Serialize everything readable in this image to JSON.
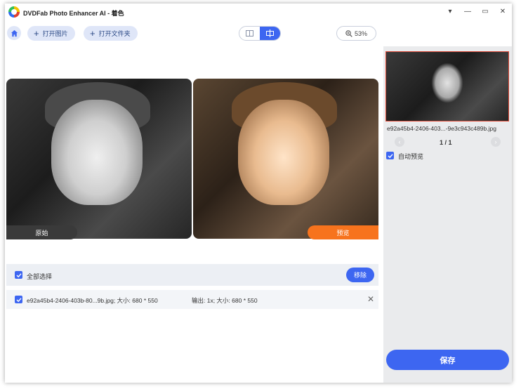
{
  "window": {
    "title": "DVDFab Photo Enhancer AI - 着色"
  },
  "window_controls": {
    "menu_icon": "▾",
    "minimize_icon": "—",
    "maximize_icon": "▭",
    "close_icon": "✕"
  },
  "toolbar": {
    "open_image_label": "打开图片",
    "open_folder_label": "打开文件夹",
    "plus_glyph": "+",
    "zoom": "53%"
  },
  "images": {
    "original_label": "原始",
    "preview_label": "预览"
  },
  "list": {
    "select_all_label": "全部选择",
    "remove_label": "移除",
    "rows": [
      {
        "file": "e92a45b4-2406-403b-80...9b.jpg; 大小: 680 * 550",
        "output": "输出: 1x; 大小: 680 * 550"
      }
    ]
  },
  "right_panel": {
    "thumb_name": "e92a45b4-2406-403...-9e3c943c489b.jpg",
    "page": "1 / 1",
    "prev_glyph": "‹",
    "next_glyph": "›",
    "auto_preview_label": "自动预览",
    "save_label": "保存"
  },
  "colors": {
    "accent": "#3d66f1",
    "preview_tag": "#f7731d",
    "original_tag": "#3a3a3a"
  }
}
